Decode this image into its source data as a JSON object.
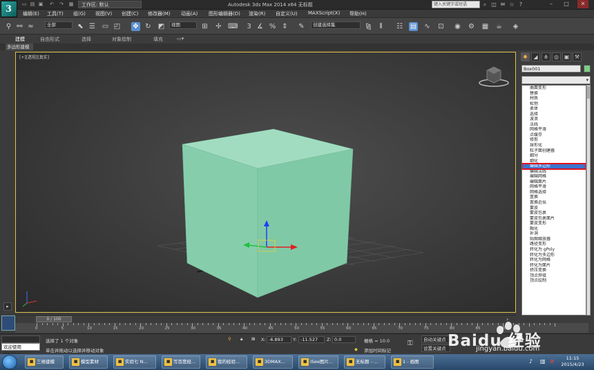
{
  "app": {
    "workspace_label": "工作区: 默认",
    "window_title": "Autodesk 3ds Max  2014 x64      无标题",
    "search_placeholder": "键入关键字或短语"
  },
  "menu": [
    "编辑(E)",
    "工具(T)",
    "组(G)",
    "视图(V)",
    "创建(C)",
    "修改器(M)",
    "动画(A)",
    "图形编辑器(D)",
    "渲染(R)",
    "自定义(U)",
    "MAXScript(X)",
    "帮助(H)"
  ],
  "toolbar": {
    "selection_filter": "全部",
    "coord_system": "视图",
    "named_selection": "创建选择集"
  },
  "ribbon": {
    "tabs": [
      "建模",
      "自由形式",
      "选择",
      "对象绘制",
      "填充"
    ],
    "sub_tab": "多边形建模"
  },
  "viewport": {
    "label": "[+][透视][真实]"
  },
  "command_panel": {
    "object_name": "Box001",
    "object_color": "#7ccf86",
    "modifiers": [
      "曲面变形",
      "替换",
      "材质",
      "松弛",
      "柔体",
      "选择",
      "波浪",
      "法线",
      "网格平滑",
      "点缓存",
      "修剪",
      "球形化",
      "粒子面创建器",
      "细分",
      "细化",
      "编辑多边形",
      "编辑法线",
      "编辑网格",
      "编辑面片",
      "网格平滑",
      "网格选择",
      "置换",
      "置换近似",
      "蒙皮",
      "蒙皮包裹",
      "蒙皮包裹面片",
      "蒙皮变形",
      "融化",
      "补洞",
      "贴图缩放器",
      "路径变形",
      "转化为 gPoly",
      "转化为多边形",
      "转化为网格",
      "转化为面片",
      "挤压变换",
      "顶点焊接",
      "顶点绘制"
    ],
    "selected_modifier": "编辑多边形"
  },
  "timeline": {
    "frame_display": "0 / 100",
    "ruler_labels": [
      "0",
      "5",
      "10",
      "15",
      "20",
      "25",
      "30",
      "35",
      "40",
      "45",
      "50",
      "55",
      "60",
      "65",
      "70",
      "75",
      "80",
      "85",
      "90"
    ]
  },
  "status": {
    "maxscript_label": "欢迎使用 MAXScr",
    "selection_text": "选择了 1 个对象",
    "prompt_text": "单击并拖动以选择并移动对象",
    "x_label": "X:",
    "x_value": "-6.893",
    "y_label": "Y:",
    "y_value": "-11.527",
    "z_label": "Z:",
    "z_value": "0.0",
    "grid_text": "栅格 = 10.0",
    "auto_key": "自动关键点",
    "set_key": "设置关键点",
    "add_time_tag": "添加时间标记"
  },
  "taskbar": {
    "tasks": [
      "三维建模",
      "模型素材",
      "实验七 N...",
      "写百度经...",
      "我的经验...",
      "3DMAX...",
      "iSee图片...",
      "无标题 - ...",
      "1 - 画图"
    ],
    "time": "11:15",
    "date": "2015/4/23"
  },
  "watermark": {
    "brand": "Baidu 经验",
    "url": "jingyan.baidu.com"
  },
  "colors": {
    "accent": "#5a8fd0",
    "selection_highlight": "#3a74cf",
    "highlight_box": "#e0121c",
    "box_front": "#86ceab",
    "box_top": "#a2dcc0",
    "box_side": "#6fbf99"
  }
}
